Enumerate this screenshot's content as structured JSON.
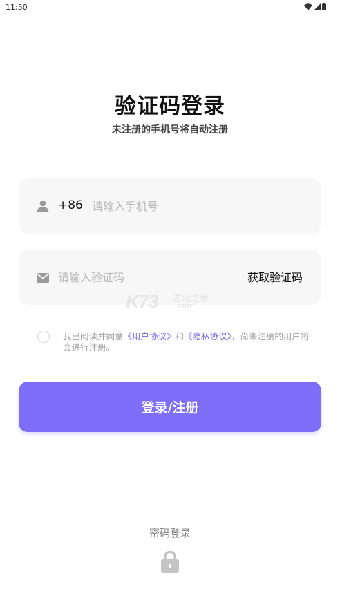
{
  "status_bar": {
    "time": "11:50"
  },
  "header": {
    "title": "验证码登录",
    "subtitle": "未注册的手机号将自动注册"
  },
  "phone": {
    "country_code": "+86",
    "placeholder": "请输入手机号",
    "value": ""
  },
  "code": {
    "placeholder": "请输入验证码",
    "value": "",
    "get_code_label": "获取验证码"
  },
  "agreement": {
    "checked": false,
    "prefix": "我已阅读并同意",
    "user_agreement": "《用户协议》",
    "conjunction": "和",
    "privacy_policy": "《隐私协议》",
    "suffix": "，尚未注册的用户将会进行注册。"
  },
  "login_button_label": "登录/注册",
  "watermark": {
    "logo": "K73",
    "text": "游戏之家",
    "sub": ".com"
  },
  "footer": {
    "password_login_label": "密码登录"
  },
  "colors": {
    "accent": "#7e6ef7",
    "link": "#7369e8",
    "field_bg": "#f7f7f7",
    "placeholder": "#b9b9b9"
  },
  "icons": {
    "wifi": "wifi-icon",
    "signal": "signal-icon",
    "battery": "battery-icon",
    "user": "user-icon",
    "mail": "mail-icon",
    "lock": "lock-icon"
  }
}
